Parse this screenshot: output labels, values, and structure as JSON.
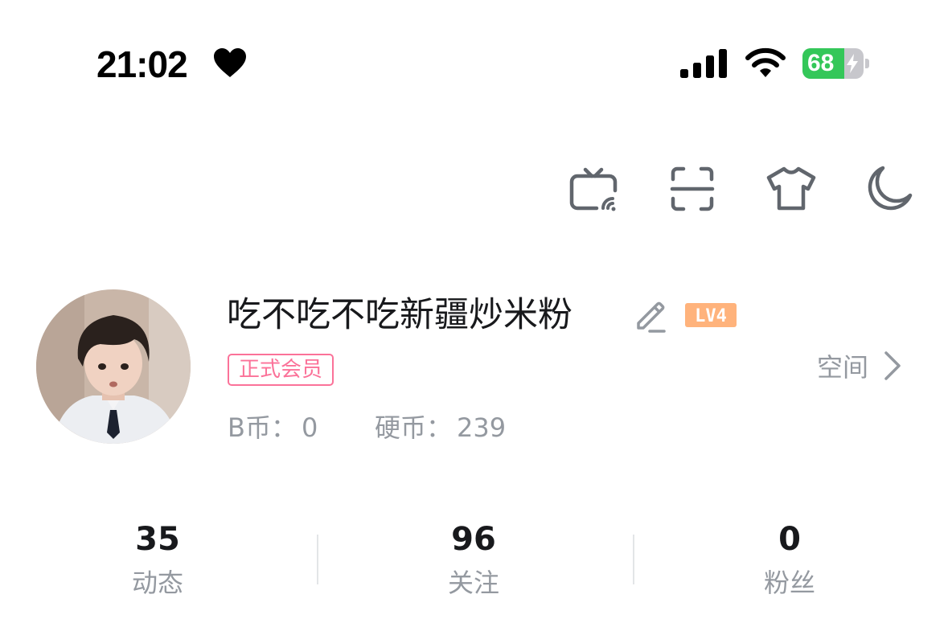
{
  "status_bar": {
    "time": "21:02",
    "battery_percent": "68",
    "battery_level": 0.68,
    "battery_charging": true,
    "icons": [
      "heart-icon",
      "cellular-signal-icon",
      "wifi-icon",
      "battery-icon"
    ]
  },
  "toolbar": {
    "icons": [
      "tv-cast-icon",
      "scan-icon",
      "shirt-icon",
      "moon-icon"
    ]
  },
  "profile": {
    "username": "吃不吃不吃新疆炒米粉",
    "level": "LV4",
    "vip_label": "正式会员",
    "space_label": "空间",
    "b_coin_label": "B币：",
    "b_coin_value": "0",
    "coin_label": "硬币：",
    "coin_value": "239"
  },
  "stats": [
    {
      "value": "35",
      "label": "动态"
    },
    {
      "value": "96",
      "label": "关注"
    },
    {
      "value": "0",
      "label": "粉丝"
    }
  ],
  "colors": {
    "accent_pink": "#fb7299",
    "level_orange": "#ffb37c",
    "muted_text": "#9499a0",
    "icon_gray": "#61666d",
    "battery_green": "#34c759"
  }
}
